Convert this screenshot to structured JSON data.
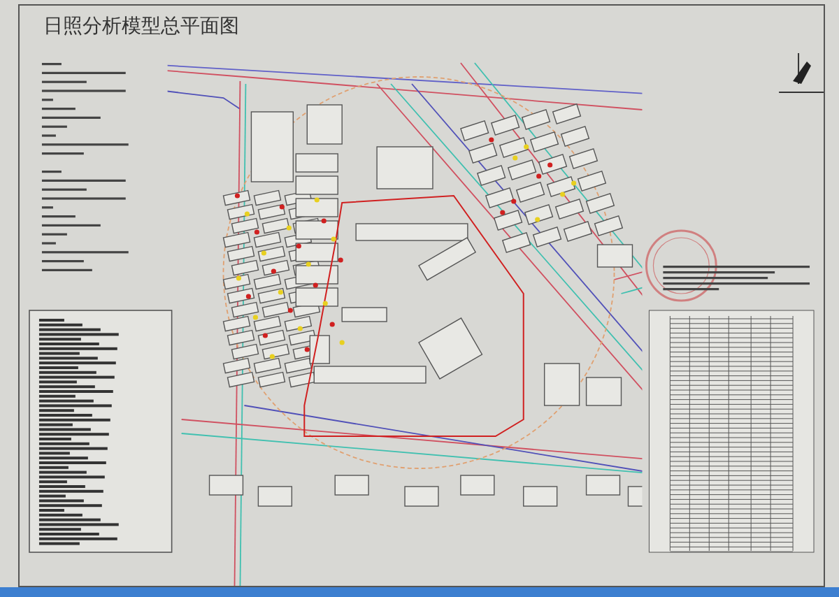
{
  "drawing": {
    "title": "日照分析模型总平面图"
  }
}
